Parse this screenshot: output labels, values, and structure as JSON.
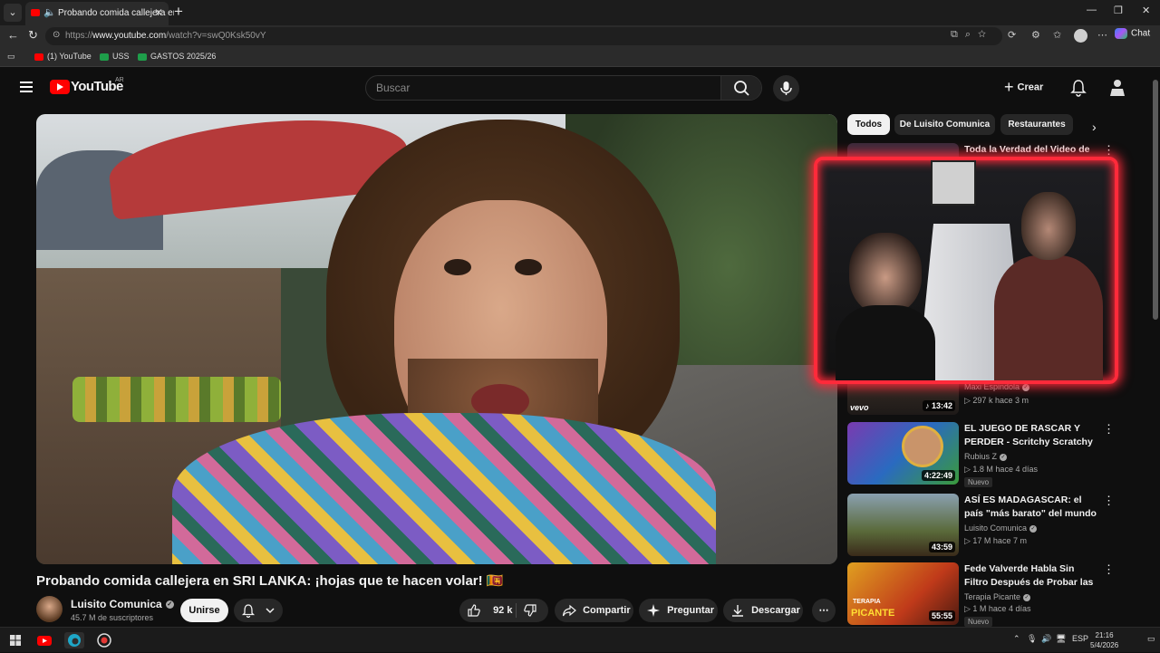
{
  "browser": {
    "tab_title": "Probando comida callejera en SRI LANKA",
    "url_prefix": "https://",
    "url_domain": "www.youtube.com",
    "url_path": "/watch?v=swQ0Ksk50vY",
    "chat_label": "Chat",
    "bookmarks": [
      "(1) YouTube",
      "USS",
      "GASTOS 2025/26"
    ]
  },
  "youtube": {
    "logo_text": "YouTube",
    "country_code": "AR",
    "search_placeholder": "Buscar",
    "create_label": "Crear"
  },
  "video": {
    "title": "Probando comida callejera en SRI LANKA: ¡hojas que te hacen volar! 🇱🇰",
    "channel": "Luisito Comunica",
    "subscribers": "45.7 M de suscriptores",
    "join_label": "Unirse",
    "likes": "92 k",
    "share_label": "Compartir",
    "ask_label": "Preguntar",
    "download_label": "Descargar"
  },
  "chips": [
    "Todos",
    "De Luisito Comunica",
    "Restaurantes"
  ],
  "recommendations": [
    {
      "title": "Toda la Verdad del Video de",
      "channel": "",
      "meta": "",
      "duration": "",
      "badge": "",
      "thumb_color": "#3a2a3a"
    },
    {
      "title": "",
      "channel": "Maxi Espindola",
      "meta": "▷ 297 k  hace 3 m",
      "duration": "♪ 13:42",
      "badge": "",
      "thumb_color": "#2a2624"
    },
    {
      "title": "EL JUEGO DE RASCAR Y PERDER - Scritchy Scratchy ...",
      "channel": "Rubius Z",
      "meta": "▷ 1.8 M  hace 4 días",
      "duration": "4:22:49",
      "badge": "Nuevo",
      "thumb_color": "#7a3ab0"
    },
    {
      "title": "ASÍ ES MADAGASCAR: el país \"más barato\" del mundo | ...",
      "channel": "Luisito Comunica",
      "meta": "▷ 17 M  hace 7 m",
      "duration": "43:59",
      "badge": "",
      "thumb_color": "#5a6a3a"
    },
    {
      "title": "Fede Valverde Habla Sin Filtro Después de Probar las Salsas ...",
      "channel": "Terapia Picante",
      "meta": "▷ 1 M  hace 4 días",
      "duration": "55:55",
      "badge": "Nuevo",
      "thumb_color": "#c03a1a"
    }
  ],
  "thumb_texts": {
    "vevo": "vevo",
    "picante": "PICANTE",
    "terapia": "TERAPIA"
  },
  "taskbar": {
    "lang": "ESP",
    "time": "21:16",
    "date": "5/4/2026"
  }
}
